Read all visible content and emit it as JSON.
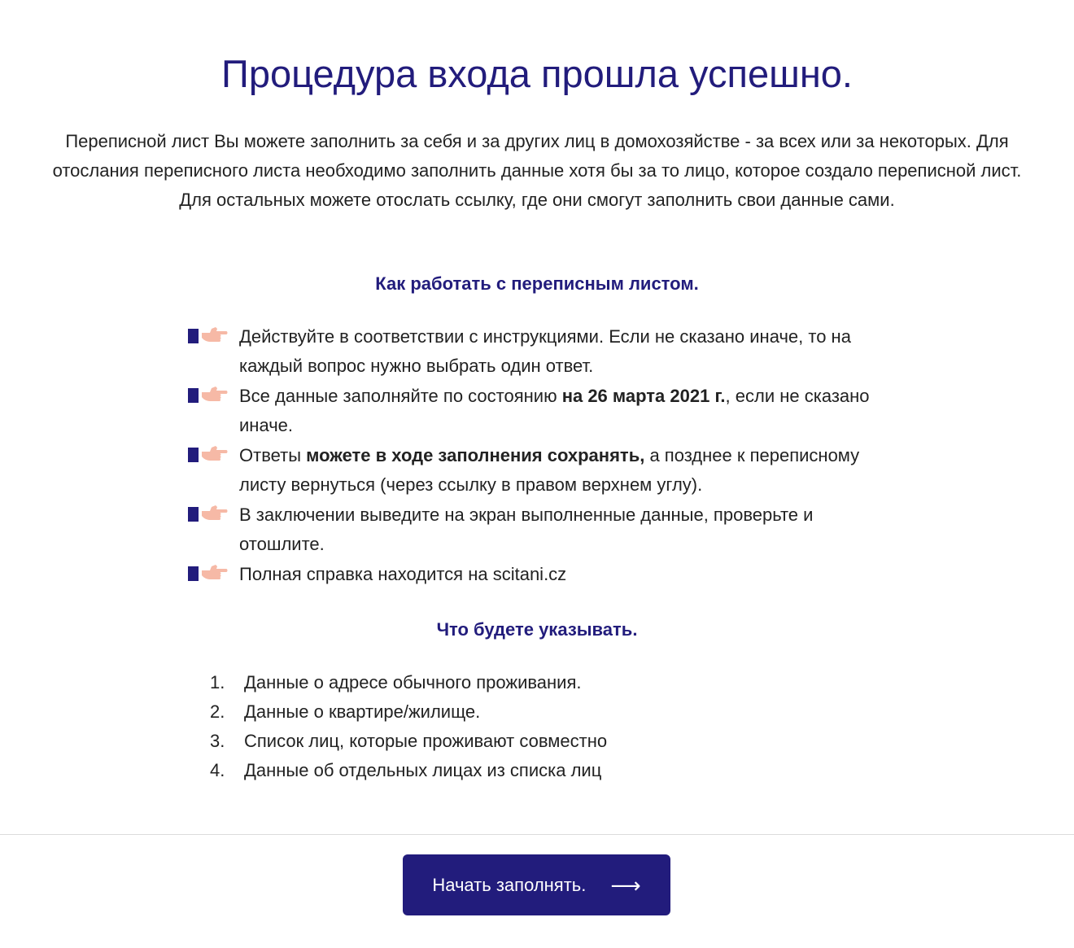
{
  "title": "Процедура входа прошла успешно.",
  "intro": "Переписной лист Вы можете заполнить за себя и за других лиц в домохозяйстве - за всех или за некоторых. Для отослания переписного листа необходимо заполнить данные хотя бы за то лицо, которое создало переписной лист. Для остальных можете отослать ссылку, где они смогут заполнить свои данные сами.",
  "how_heading": "Как работать с переписным листом.",
  "rules": [
    {
      "before": "Действуйте в соответствии с инструкциями. Если не сказано иначе, то на каждый вопрос нужно выбрать один ответ.",
      "bold": "",
      "after": ""
    },
    {
      "before": "Все данные заполняйте по состоянию ",
      "bold": "на 26 марта 2021 г.",
      "after": ", если не сказано иначе."
    },
    {
      "before": "Ответы ",
      "bold": "можете в ходе заполнения сохранять,",
      "after": " а позднее к переписному листу вернуться (через ссылку в правом верхнем углу)."
    },
    {
      "before": "В заключении выведите на экран выполненные данные, проверьте и отошлите.",
      "bold": "",
      "after": ""
    },
    {
      "before": "Полная справка находится на scitani.cz",
      "bold": "",
      "after": ""
    }
  ],
  "bullet_icon": "pointing-hand-icon",
  "colors": {
    "accent": "#221c7c",
    "hand": "#f6b9a6",
    "text": "#222222",
    "divider": "#dcdcdc"
  },
  "what_heading": "Что будете указывать.",
  "steps": [
    {
      "num": "1.",
      "text": "Данные о адресе обычного проживания."
    },
    {
      "num": "2.",
      "text": "Данные о квартире/жилище."
    },
    {
      "num": "3.",
      "text": "Список лиц, которые проживают совместно"
    },
    {
      "num": "4.",
      "text": "Данные об отдельных лицах из списка лиц"
    }
  ],
  "start_button": {
    "label": "Начать заполнять.",
    "arrow": "⟶"
  }
}
